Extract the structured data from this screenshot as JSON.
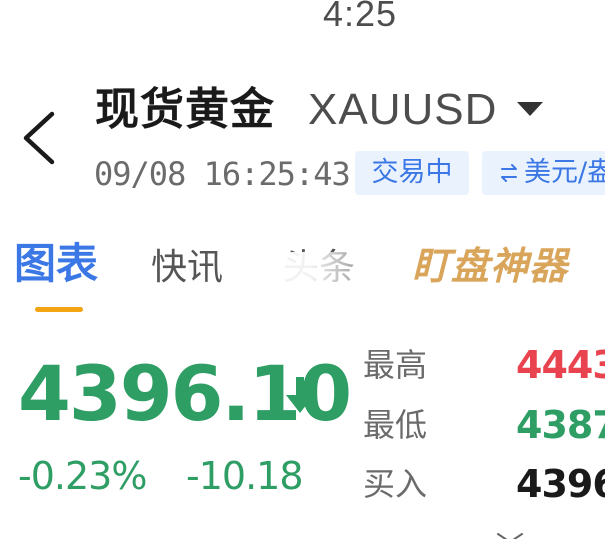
{
  "status_bar": {
    "time": "4:25"
  },
  "header": {
    "title": "现货黄金",
    "symbol": "XAUUSD",
    "datetime": "09/08 16:25:43",
    "trading_status": "交易中",
    "currency_label": "美元/盎"
  },
  "tabs": {
    "chart": "图表",
    "flash": "快讯",
    "headlines": "头条",
    "tool": "盯盘神器",
    "active": "图表"
  },
  "quote": {
    "price": "4396.10",
    "change_pct": "-0.23%",
    "change_abs": "-10.18",
    "direction": "down"
  },
  "stats": {
    "high_label": "最高",
    "high_value": "4443",
    "low_label": "最低",
    "low_value": "4387",
    "buy_label": "买入",
    "buy_value": "4396"
  },
  "colors": {
    "accent_blue": "#3b78e6",
    "down_green": "#2e9e64",
    "up_red": "#e8434f",
    "tab_indicator": "#f2a411",
    "tool_gold": "#d9a55a"
  }
}
